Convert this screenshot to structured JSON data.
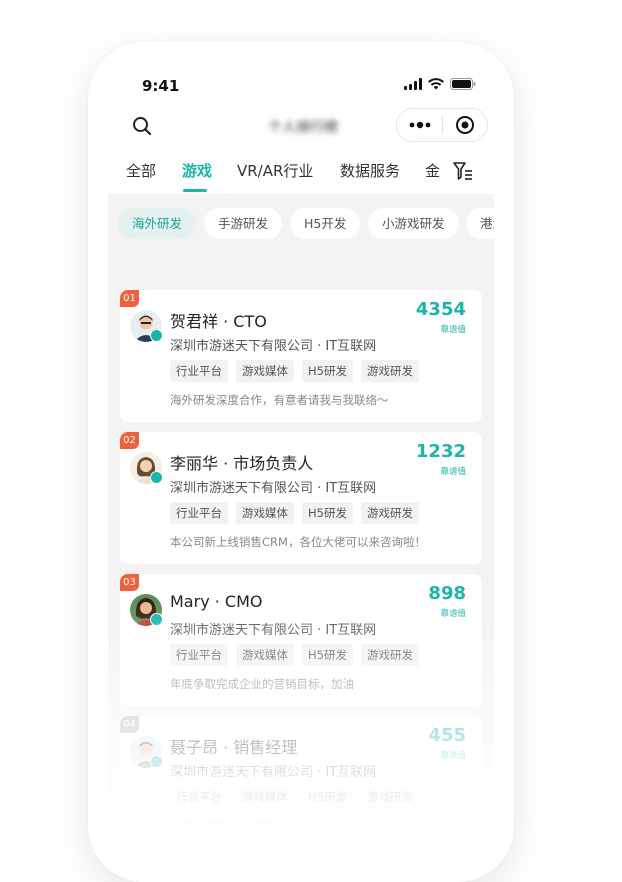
{
  "status_bar": {
    "time": "9:41"
  },
  "nav": {
    "title": "个人排行榜"
  },
  "tabs": [
    {
      "label": "全部",
      "active": false
    },
    {
      "label": "游戏",
      "active": true
    },
    {
      "label": "VR/AR行业",
      "active": false
    },
    {
      "label": "数据服务",
      "active": false
    },
    {
      "label": "金",
      "active": false
    }
  ],
  "chips": [
    {
      "label": "海外研发",
      "active": true
    },
    {
      "label": "手游研发",
      "active": false
    },
    {
      "label": "H5开发",
      "active": false
    },
    {
      "label": "小游戏研发",
      "active": false
    },
    {
      "label": "港澳",
      "active": false
    }
  ],
  "cards": [
    {
      "rank": "01",
      "name": "贺君祥 · CTO",
      "company": "深圳市游迷天下有限公司 · IT互联网",
      "tags": [
        "行业平台",
        "游戏媒体",
        "H5研发",
        "游戏研发"
      ],
      "desc": "海外研发深度合作，有意者请我与我联络～",
      "score": "4354",
      "score_label": "靠谱值"
    },
    {
      "rank": "02",
      "name": "李丽华 · 市场负责人",
      "company": "深圳市游迷天下有限公司 · IT互联网",
      "tags": [
        "行业平台",
        "游戏媒体",
        "H5研发",
        "游戏研发"
      ],
      "desc": "本公司新上线销售CRM，各位大佬可以来咨询啦！",
      "score": "1232",
      "score_label": "靠谱值"
    },
    {
      "rank": "03",
      "name": "Mary · CMO",
      "company": "深圳市游迷天下有限公司 · IT互联网",
      "tags": [
        "行业平台",
        "游戏媒体",
        "H5研发",
        "游戏研发"
      ],
      "desc": "年底争取完成企业的营销目标，加油",
      "score": "898",
      "score_label": "靠谱值"
    },
    {
      "rank": "04",
      "name": "聂子昂 · 销售经理",
      "company": "深圳市游迷天下有限公司 · IT互联网",
      "tags": [
        "行业平台",
        "游戏媒体",
        "H5研发",
        "游戏研发"
      ],
      "desc": "热爱，坚持就会成功",
      "score": "455",
      "score_label": "靠谱值"
    }
  ],
  "colors": {
    "accent": "#1ab6a8",
    "rank_badge": "#f2603b"
  },
  "icons": {
    "search": "search-icon",
    "more": "more-dots-icon",
    "close": "mini-program-close-icon",
    "filter": "filter-icon",
    "verified": "verified-icon"
  }
}
